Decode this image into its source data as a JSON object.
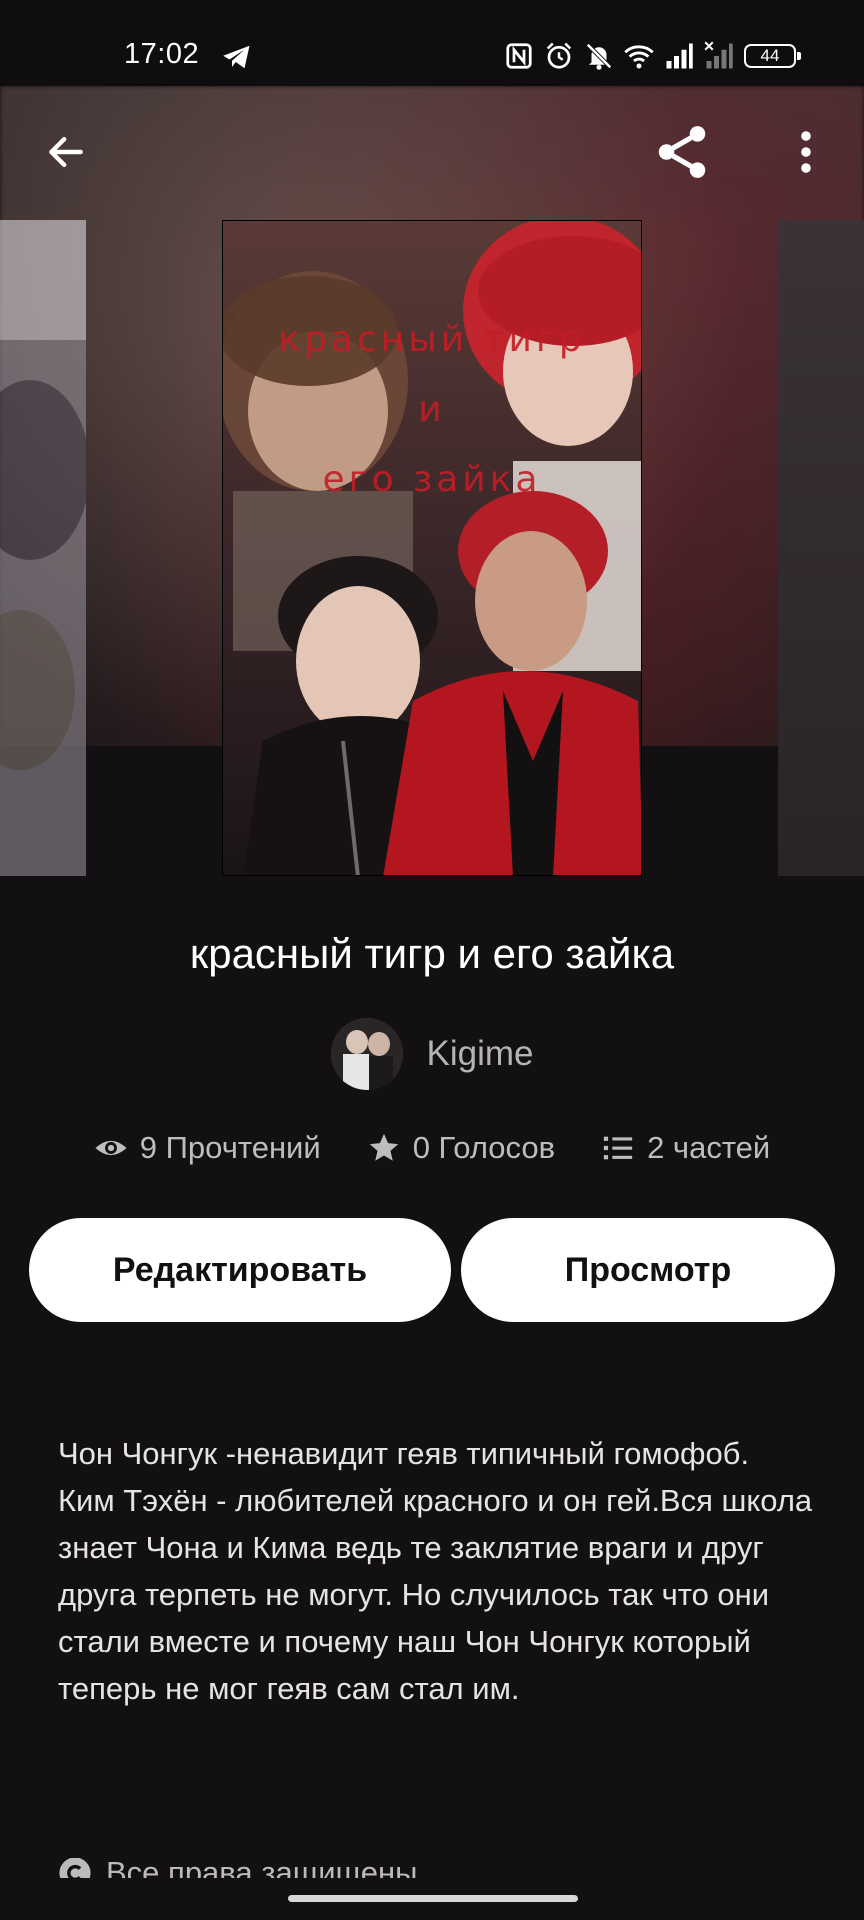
{
  "status_bar": {
    "time": "17:02",
    "battery": "44"
  },
  "app_bar": {
    "back_icon": "arrow-left-icon",
    "share_icon": "share-icon",
    "menu_icon": "more-vertical-icon"
  },
  "cover": {
    "title_line1": "красный тигр",
    "title_line2": "и",
    "title_line3": "его зайка"
  },
  "story": {
    "title": "красный тигр и его зайка",
    "author": "Kigime"
  },
  "stats": {
    "reads": "9 Прочтений",
    "votes": "0 Голосов",
    "parts": "2 частей"
  },
  "actions": {
    "edit_label": "Редактировать",
    "view_label": "Просмотр"
  },
  "description": "Чон Чонгук -ненавидит геяв типичный гомофоб.\nКим Тэхён - любителей красного и он гей.Вся школа знает Чона и Кима ведь те заклятие враги и друг друга терпеть не могут. Но случилось так что они стали вместе и почему наш Чон Чонгук который теперь не мог геяв сам стал им.",
  "footer": {
    "copyright": "Все права защищены"
  },
  "colors": {
    "background": "#121012",
    "button_bg": "#ffffff",
    "cover_text": "#c21d24"
  }
}
